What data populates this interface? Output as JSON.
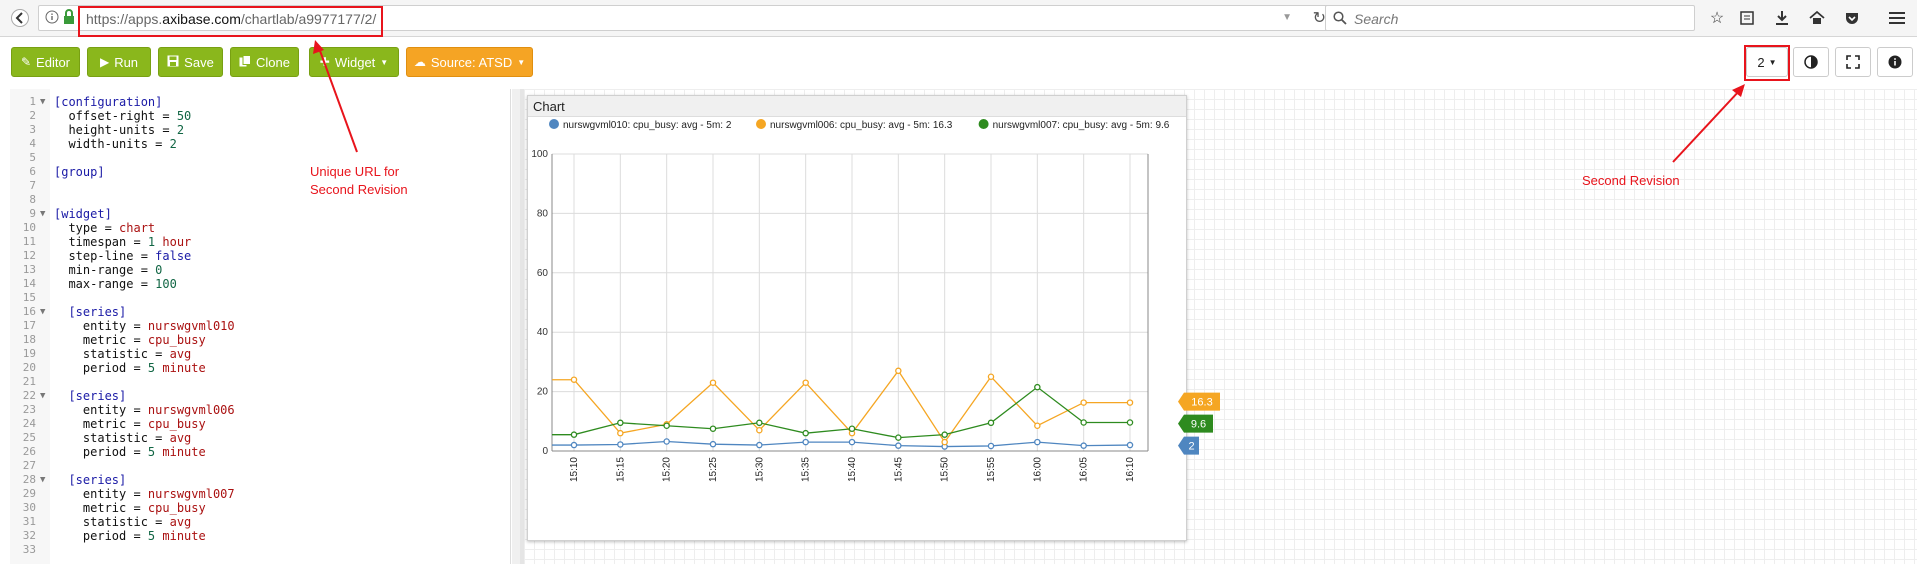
{
  "browser": {
    "url_prefix": "https://apps.",
    "url_domain": "axibase.com",
    "url_path": "/chartlab/a9977177/2/",
    "search_placeholder": "Search"
  },
  "toolbar": {
    "editor_label": "Editor",
    "run_label": "Run",
    "save_label": "Save",
    "clone_label": "Clone",
    "widget_label": "Widget",
    "source_label": "Source: ATSD",
    "revision_label": "2"
  },
  "editor": {
    "lines": [
      {
        "n": "1",
        "fold": true,
        "parts": [
          {
            "t": "[configuration]",
            "c": "sec"
          }
        ]
      },
      {
        "n": "2",
        "parts": [
          {
            "t": "  offset-right = ",
            "c": "key"
          },
          {
            "t": "50",
            "c": "num"
          }
        ]
      },
      {
        "n": "3",
        "parts": [
          {
            "t": "  height-units = ",
            "c": "key"
          },
          {
            "t": "2",
            "c": "num"
          }
        ]
      },
      {
        "n": "4",
        "parts": [
          {
            "t": "  width-units = ",
            "c": "key"
          },
          {
            "t": "2",
            "c": "num"
          }
        ]
      },
      {
        "n": "5",
        "parts": []
      },
      {
        "n": "6",
        "parts": [
          {
            "t": "[group]",
            "c": "sec"
          }
        ]
      },
      {
        "n": "7",
        "parts": []
      },
      {
        "n": "8",
        "parts": []
      },
      {
        "n": "9",
        "fold": true,
        "parts": [
          {
            "t": "[widget]",
            "c": "sec"
          }
        ]
      },
      {
        "n": "10",
        "parts": [
          {
            "t": "  type = ",
            "c": "key"
          },
          {
            "t": "chart",
            "c": "str"
          }
        ]
      },
      {
        "n": "11",
        "parts": [
          {
            "t": "  timespan = ",
            "c": "key"
          },
          {
            "t": "1",
            "c": "num"
          },
          {
            "t": " hour",
            "c": "str"
          }
        ]
      },
      {
        "n": "12",
        "parts": [
          {
            "t": "  step-line = ",
            "c": "key"
          },
          {
            "t": "false",
            "c": "sec"
          }
        ]
      },
      {
        "n": "13",
        "parts": [
          {
            "t": "  min-range = ",
            "c": "key"
          },
          {
            "t": "0",
            "c": "num"
          }
        ]
      },
      {
        "n": "14",
        "parts": [
          {
            "t": "  max-range = ",
            "c": "key"
          },
          {
            "t": "100",
            "c": "num"
          }
        ]
      },
      {
        "n": "15",
        "parts": []
      },
      {
        "n": "16",
        "fold": true,
        "parts": [
          {
            "t": "  [series]",
            "c": "sec"
          }
        ]
      },
      {
        "n": "17",
        "parts": [
          {
            "t": "    entity = ",
            "c": "key"
          },
          {
            "t": "nurswgvml010",
            "c": "str"
          }
        ]
      },
      {
        "n": "18",
        "parts": [
          {
            "t": "    metric = ",
            "c": "key"
          },
          {
            "t": "cpu_busy",
            "c": "str"
          }
        ]
      },
      {
        "n": "19",
        "parts": [
          {
            "t": "    statistic = ",
            "c": "key"
          },
          {
            "t": "avg",
            "c": "str"
          }
        ]
      },
      {
        "n": "20",
        "parts": [
          {
            "t": "    period = ",
            "c": "key"
          },
          {
            "t": "5",
            "c": "num"
          },
          {
            "t": " minute",
            "c": "str"
          }
        ]
      },
      {
        "n": "21",
        "parts": []
      },
      {
        "n": "22",
        "fold": true,
        "parts": [
          {
            "t": "  [series]",
            "c": "sec"
          }
        ]
      },
      {
        "n": "23",
        "parts": [
          {
            "t": "    entity = ",
            "c": "key"
          },
          {
            "t": "nurswgvml006",
            "c": "str"
          }
        ]
      },
      {
        "n": "24",
        "parts": [
          {
            "t": "    metric = ",
            "c": "key"
          },
          {
            "t": "cpu_busy",
            "c": "str"
          }
        ]
      },
      {
        "n": "25",
        "parts": [
          {
            "t": "    statistic = ",
            "c": "key"
          },
          {
            "t": "avg",
            "c": "str"
          }
        ]
      },
      {
        "n": "26",
        "parts": [
          {
            "t": "    period = ",
            "c": "key"
          },
          {
            "t": "5",
            "c": "num"
          },
          {
            "t": " minute",
            "c": "str"
          }
        ]
      },
      {
        "n": "27",
        "parts": []
      },
      {
        "n": "28",
        "fold": true,
        "parts": [
          {
            "t": "  [series]",
            "c": "sec"
          }
        ]
      },
      {
        "n": "29",
        "parts": [
          {
            "t": "    entity = ",
            "c": "key"
          },
          {
            "t": "nurswgvml007",
            "c": "str"
          }
        ]
      },
      {
        "n": "30",
        "parts": [
          {
            "t": "    metric = ",
            "c": "key"
          },
          {
            "t": "cpu_busy",
            "c": "str"
          }
        ]
      },
      {
        "n": "31",
        "parts": [
          {
            "t": "    statistic = ",
            "c": "key"
          },
          {
            "t": "avg",
            "c": "str"
          }
        ]
      },
      {
        "n": "32",
        "parts": [
          {
            "t": "    period = ",
            "c": "key"
          },
          {
            "t": "5",
            "c": "num"
          },
          {
            "t": " minute",
            "c": "str"
          }
        ]
      },
      {
        "n": "33",
        "parts": []
      }
    ]
  },
  "widget": {
    "title": "Chart"
  },
  "annotations": {
    "url_note": [
      "Unique URL for",
      "Second Revision"
    ],
    "revision_note": "Second Revision"
  },
  "colors": {
    "green_button": "#8ab71c",
    "orange_button": "#f5a424",
    "annotation_red": "#e8141c"
  },
  "chart_data": {
    "type": "line",
    "x": [
      "15:10",
      "15:15",
      "15:20",
      "15:25",
      "15:30",
      "15:35",
      "15:40",
      "15:45",
      "15:50",
      "15:55",
      "16:00",
      "16:05",
      "16:10"
    ],
    "ylim": [
      0,
      100
    ],
    "yticks": [
      0,
      20,
      40,
      60,
      80,
      100
    ],
    "grid": true,
    "legend_position": "top",
    "series": [
      {
        "name": "nurswgvml010: cpu_busy: avg - 5m: 2",
        "color": "#4f86c0",
        "badge": "2",
        "values": [
          2,
          2.2,
          3.2,
          2.3,
          2,
          3,
          3,
          1.8,
          1.5,
          1.7,
          3,
          1.8,
          2
        ]
      },
      {
        "name": "nurswgvml006: cpu_busy: avg - 5m: 16.3",
        "color": "#f5a623",
        "badge": "16.3",
        "values": [
          24,
          6,
          9,
          23,
          7,
          23,
          6,
          27,
          3,
          25,
          8.5,
          16.3,
          16.3
        ]
      },
      {
        "name": "nurswgvml007: cpu_busy: avg - 5m: 9.6",
        "color": "#2e8b1f",
        "badge": "9.6",
        "values": [
          5.5,
          9.5,
          8.5,
          7.5,
          9.5,
          6,
          7.5,
          4.5,
          5.5,
          9.5,
          21.5,
          9.6,
          9.6
        ]
      }
    ]
  }
}
